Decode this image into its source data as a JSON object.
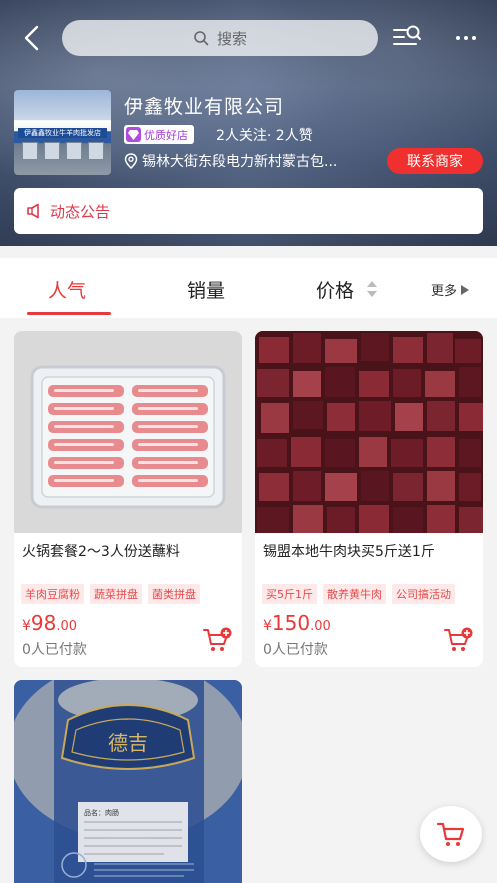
{
  "header": {
    "search_placeholder": "搜索",
    "colors": {
      "accent": "#e8393a",
      "button": "#f0302e",
      "good_shop": "#b04be0"
    }
  },
  "shop": {
    "photo_sign": "伊鑫鑫牧业牛羊肉批发店",
    "name": "伊鑫牧业有限公司",
    "badge": "优质好店",
    "follow_text": "2人关注· 2人赞",
    "address": "锡林大街东段电力新村蒙古包...",
    "contact_label": "联系商家",
    "notice_label": "动态公告"
  },
  "tabs": [
    {
      "label": "人气",
      "active": true
    },
    {
      "label": "销量",
      "active": false
    },
    {
      "label": "价格",
      "active": false
    },
    {
      "label": "更多",
      "active": false
    }
  ],
  "products": [
    {
      "title": "火锅套餐2～3人份送蘸料",
      "tags": [
        "羊肉豆腐粉",
        "蔬菜拼盘",
        "菌类拼盘"
      ],
      "price_symbol": "¥",
      "price_int": "98",
      "price_dec": ".00",
      "sold": "0人已付款",
      "image": "frozen-lamb-slices"
    },
    {
      "title": "锡盟本地牛肉块买5斤送1斤",
      "tags": [
        "买5斤1斤",
        "散养黄牛肉",
        "公司搞活动"
      ],
      "price_symbol": "¥",
      "price_int": "150",
      "price_dec": ".00",
      "sold": "0人已付款",
      "image": "beef-cubes"
    },
    {
      "image": "packaged-meat",
      "package_text": "德吉",
      "label_text": "品名：肉肠"
    }
  ]
}
